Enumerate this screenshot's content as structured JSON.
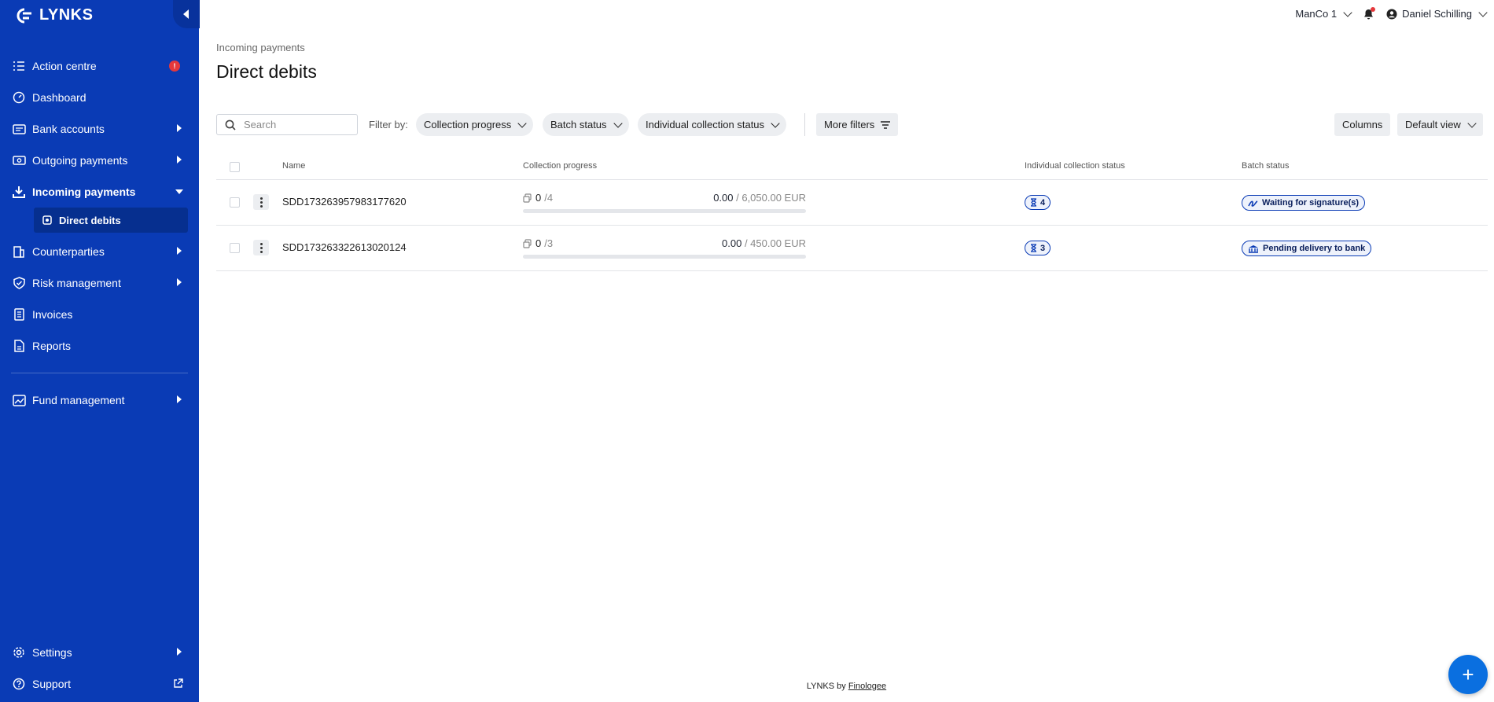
{
  "app": {
    "brand": "LYNKS"
  },
  "sidebar": {
    "items": [
      {
        "label": "Action centre",
        "icon": "list-check-icon",
        "alert": "!"
      },
      {
        "label": "Dashboard",
        "icon": "gauge-icon"
      },
      {
        "label": "Bank accounts",
        "icon": "bank-card-icon"
      },
      {
        "label": "Outgoing payments",
        "icon": "money-out-icon"
      },
      {
        "label": "Incoming payments",
        "icon": "download-icon"
      },
      {
        "label": "Direct debits",
        "icon": "direct-debit-icon"
      },
      {
        "label": "Counterparties",
        "icon": "building-icon"
      },
      {
        "label": "Risk management",
        "icon": "shield-icon"
      },
      {
        "label": "Invoices",
        "icon": "invoice-icon"
      },
      {
        "label": "Reports",
        "icon": "report-icon"
      },
      {
        "label": "Fund management",
        "icon": "chart-icon"
      },
      {
        "label": "Settings",
        "icon": "gear-icon"
      },
      {
        "label": "Support",
        "icon": "help-icon"
      }
    ]
  },
  "topbar": {
    "entity": "ManCo 1",
    "user": "Daniel Schilling"
  },
  "page": {
    "breadcrumb": "Incoming payments",
    "title": "Direct debits"
  },
  "toolbar": {
    "search_placeholder": "Search",
    "filter_label": "Filter by:",
    "filters": [
      "Collection progress",
      "Batch status",
      "Individual collection status"
    ],
    "more_filters": "More filters",
    "columns": "Columns",
    "view": "Default view"
  },
  "table": {
    "headers": {
      "name": "Name",
      "progress": "Collection progress",
      "individual": "Individual collection status",
      "batch": "Batch status"
    },
    "rows": [
      {
        "name": "SDD173263957983177620",
        "collected": "0",
        "total": "/4",
        "amount": "0.00",
        "amount_total": " / 6,050.00 EUR",
        "progress": 0,
        "individual_count": "4",
        "batch_status": "Waiting for signature(s)"
      },
      {
        "name": "SDD173263322613020124",
        "collected": "0",
        "total": "/3",
        "amount": "0.00",
        "amount_total": " / 450.00 EUR",
        "progress": 0,
        "individual_count": "3",
        "batch_status": "Pending delivery to bank"
      }
    ]
  },
  "footer": {
    "text": "LYNKS by ",
    "link": "Finologee"
  },
  "colors": {
    "sidebar": "#0a3bb5",
    "accent": "#0a6fe0",
    "alert": "#e5383b"
  }
}
